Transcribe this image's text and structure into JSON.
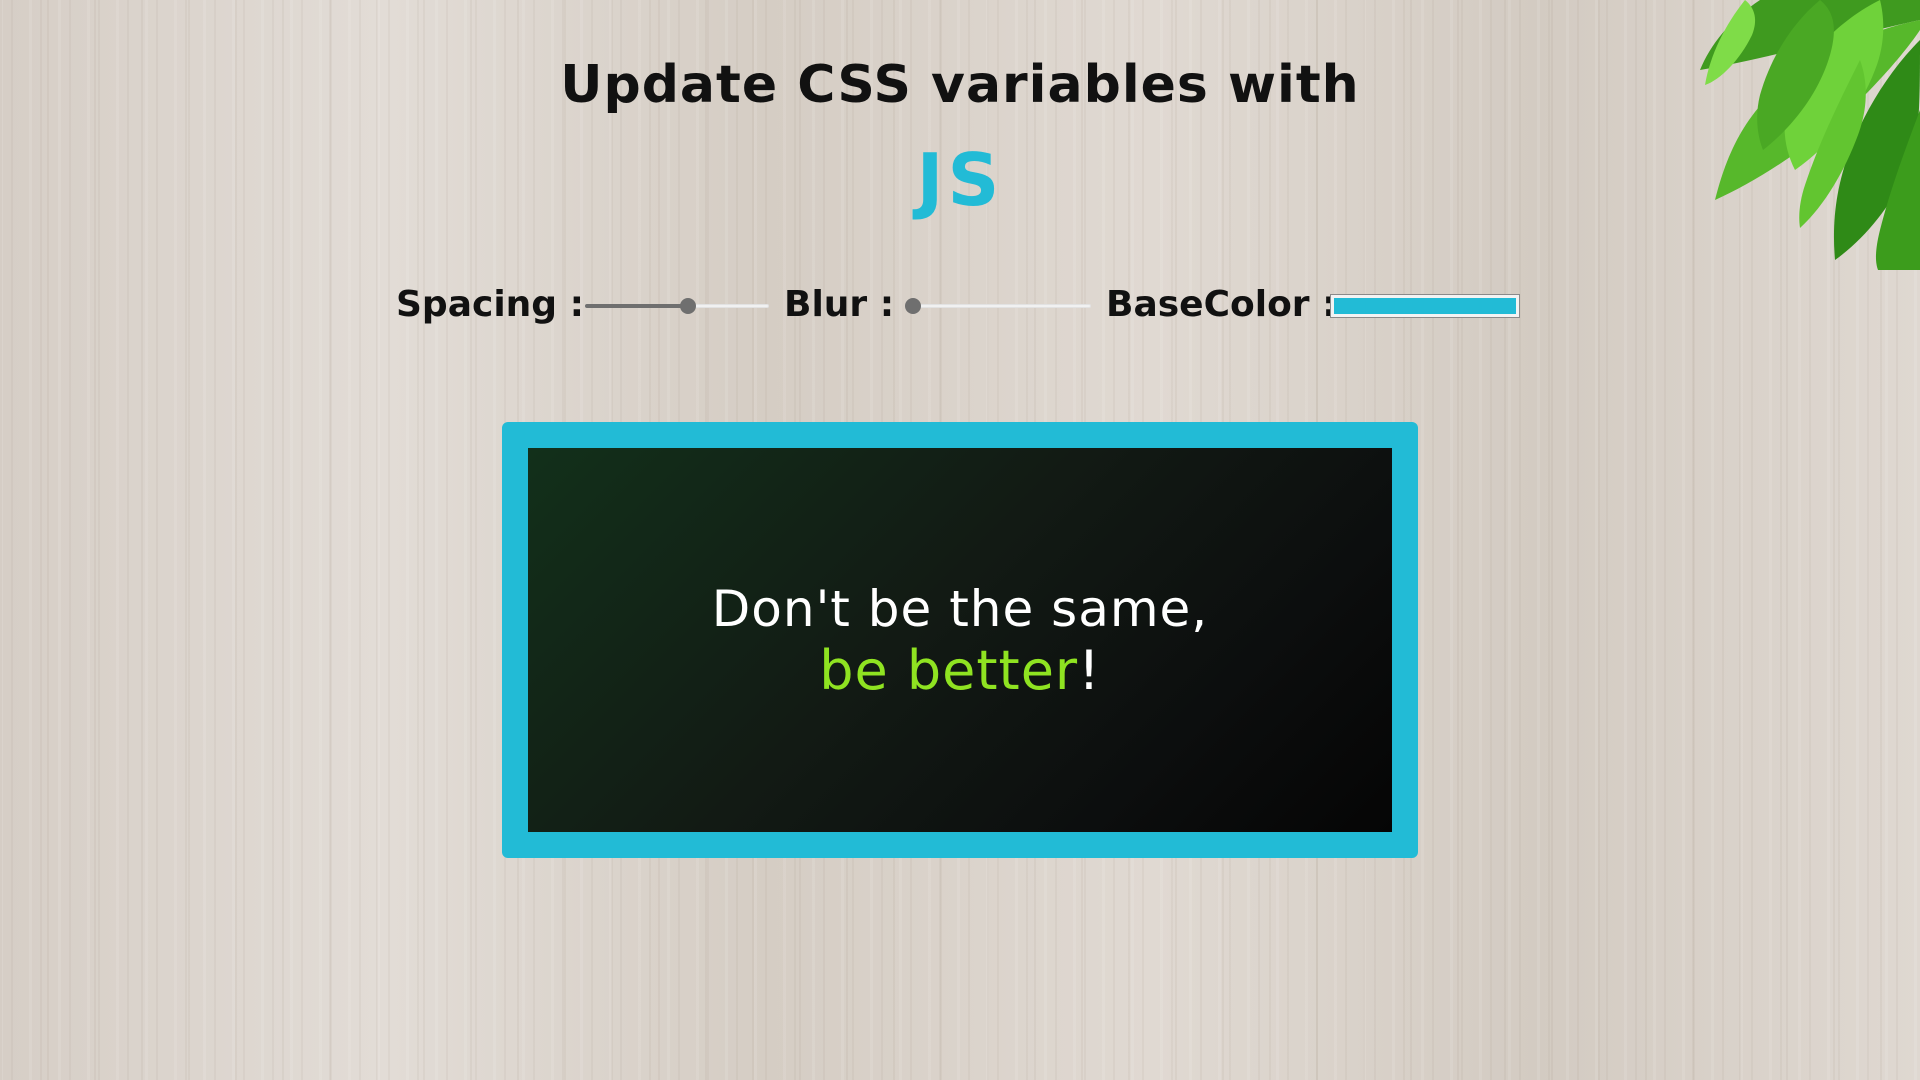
{
  "heading": {
    "title": "Update CSS variables with",
    "accent": "JS"
  },
  "controls": {
    "spacing": {
      "label": "Spacing :",
      "value_fraction": 0.56
    },
    "blur": {
      "label": "Blur :",
      "value_fraction": 0.0
    },
    "base_color": {
      "label": "BaseColor :",
      "value": "#22bbd6"
    }
  },
  "image": {
    "quote_line1": "Don't be the same,",
    "quote_accent": "be better",
    "quote_punct": "!"
  },
  "colors": {
    "accent": "#22bbd6",
    "quote_green": "#8fe321",
    "text_dark": "#111111"
  },
  "decor": {
    "corner_plant": "leaves-icon"
  }
}
